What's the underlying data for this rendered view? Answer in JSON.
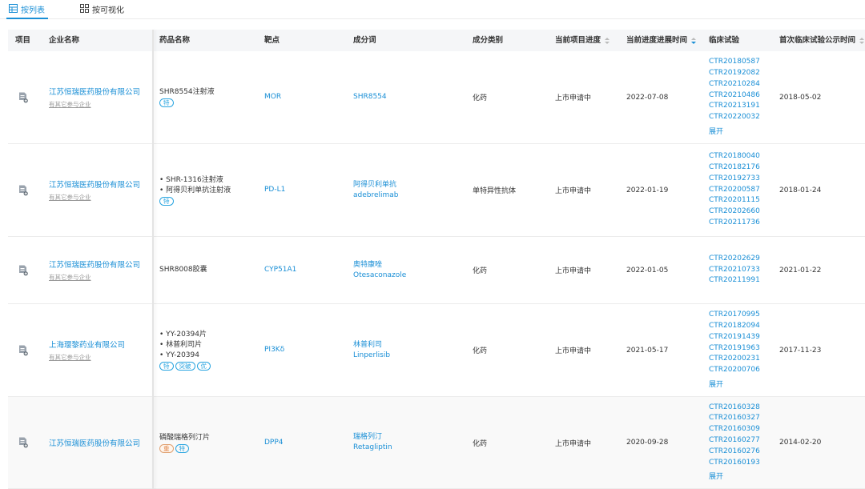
{
  "tabs": {
    "list_label": "按列表",
    "viz_label": "按可视化"
  },
  "headers": {
    "project": "项目",
    "company": "企业名称",
    "drug": "药品名称",
    "target": "靶点",
    "ingredient": "成分词",
    "category": "成分类别",
    "progress": "当前项目进度",
    "progress_time": "当前进度进展时间",
    "trials": "临床试验",
    "first_trial": "首次临床试验公示时间"
  },
  "expand_label": "展开",
  "colors": {
    "accent": "#1a8fd6",
    "tag_blue": "#2aa5e0",
    "tag_orange": "#e08a50"
  },
  "rows": [
    {
      "company": "江苏恒瑞医药股份有限公司",
      "company_sub": "有其它参与企业",
      "drugs": [
        "SHR8554注射液"
      ],
      "tags": [
        "特"
      ],
      "target": "MOR",
      "ingredient_cn": "SHR8554",
      "ingredient_en": "",
      "category": "化药",
      "progress": "上市申请中",
      "progress_time": "2022-07-08",
      "trials": [
        "CTR20180587",
        "CTR20192082",
        "CTR20210284",
        "CTR20210486",
        "CTR20213191",
        "CTR20220032"
      ],
      "first_trial": "2018-05-02"
    },
    {
      "company": "江苏恒瑞医药股份有限公司",
      "company_sub": "有其它参与企业",
      "drugs": [
        "• SHR-1316注射液",
        "• 阿得贝利单抗注射液"
      ],
      "tags": [
        "特"
      ],
      "target": "PD-L1",
      "ingredient_cn": "阿得贝利单抗",
      "ingredient_en": "adebrelimab",
      "category": "单特异性抗体",
      "progress": "上市申请中",
      "progress_time": "2022-01-19",
      "trials": [
        "CTR20180040",
        "CTR20182176",
        "CTR20192733",
        "CTR20200587",
        "CTR20201115",
        "CTR20202660",
        "CTR20211736"
      ],
      "first_trial": "2018-01-24"
    },
    {
      "company": "江苏恒瑞医药股份有限公司",
      "company_sub": "有其它参与企业",
      "drugs": [
        "SHR8008胶囊"
      ],
      "tags": [],
      "target": "CYP51A1",
      "ingredient_cn": "奥特康唑",
      "ingredient_en": "Otesaconazole",
      "category": "化药",
      "progress": "上市申请中",
      "progress_time": "2022-01-05",
      "trials": [
        "CTR20202629",
        "CTR20210733",
        "CTR20211991"
      ],
      "first_trial": "2021-01-22"
    },
    {
      "company": "上海璎黎药业有限公司",
      "company_sub": "有其它参与企业",
      "drugs": [
        "• YY-20394片",
        "• 林普利司片",
        "• YY-20394"
      ],
      "tags": [
        "特",
        "突破",
        "优"
      ],
      "target": "PI3Kδ",
      "ingredient_cn": "林普利司",
      "ingredient_en": "Linperlisib",
      "category": "化药",
      "progress": "上市申请中",
      "progress_time": "2021-05-17",
      "trials": [
        "CTR20170995",
        "CTR20182094",
        "CTR20191439",
        "CTR20191963",
        "CTR20200231",
        "CTR20200706"
      ],
      "first_trial": "2017-11-23"
    },
    {
      "company": "江苏恒瑞医药股份有限公司",
      "company_sub": "",
      "drugs": [
        "磷酸瑞格列汀片"
      ],
      "tags": [
        "重",
        "特"
      ],
      "target": "DPP4",
      "ingredient_cn": "瑞格列汀",
      "ingredient_en": "Retagliptin",
      "category": "化药",
      "progress": "上市申请中",
      "progress_time": "2020-09-28",
      "trials": [
        "CTR20160328",
        "CTR20160327",
        "CTR20160309",
        "CTR20160277",
        "CTR20160276",
        "CTR20160193"
      ],
      "first_trial": "2014-02-20"
    }
  ]
}
